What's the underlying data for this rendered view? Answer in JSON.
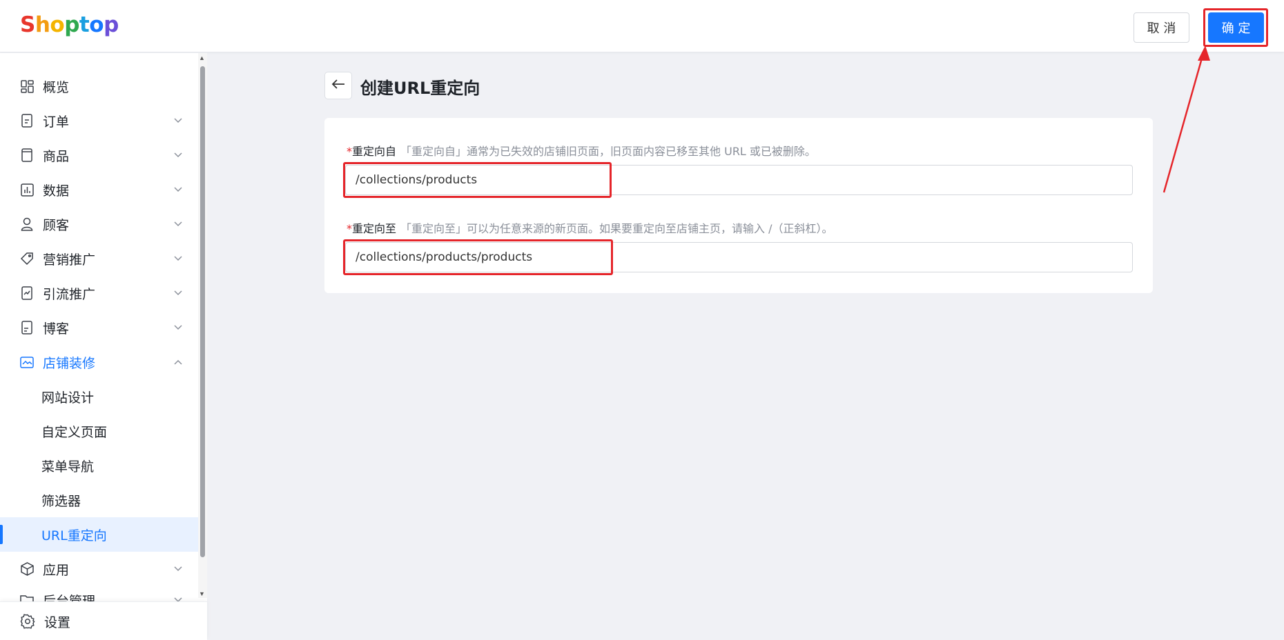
{
  "header": {
    "logo_letters": [
      {
        "ch": "S",
        "color": "#e8362c"
      },
      {
        "ch": "h",
        "color": "#f39c12"
      },
      {
        "ch": "o",
        "color": "#f4b400"
      },
      {
        "ch": "p",
        "color": "#2fa84f"
      },
      {
        "ch": "t",
        "color": "#1a9fe0"
      },
      {
        "ch": "o",
        "color": "#1677ff"
      },
      {
        "ch": "p",
        "color": "#6b4fd8"
      }
    ],
    "cancel_label": "取 消",
    "confirm_label": "确 定"
  },
  "sidebar": {
    "items": [
      {
        "label": "概览",
        "icon": "dashboard-icon",
        "has_chevron": false
      },
      {
        "label": "订单",
        "icon": "order-icon",
        "has_chevron": true
      },
      {
        "label": "商品",
        "icon": "product-icon",
        "has_chevron": true
      },
      {
        "label": "数据",
        "icon": "chart-icon",
        "has_chevron": true
      },
      {
        "label": "顾客",
        "icon": "user-icon",
        "has_chevron": true
      },
      {
        "label": "营销推广",
        "icon": "tag-icon",
        "has_chevron": true
      },
      {
        "label": "引流推广",
        "icon": "traffic-icon",
        "has_chevron": true
      },
      {
        "label": "博客",
        "icon": "blog-icon",
        "has_chevron": true
      },
      {
        "label": "店铺装修",
        "icon": "store-icon",
        "has_chevron": true,
        "expanded": true
      }
    ],
    "sub_items": [
      {
        "label": "网站设计"
      },
      {
        "label": "自定义页面"
      },
      {
        "label": "菜单导航"
      },
      {
        "label": "筛选器"
      },
      {
        "label": "URL重定向",
        "selected": true
      }
    ],
    "after_items": [
      {
        "label": "应用",
        "icon": "app-icon"
      },
      {
        "label": "后台管理",
        "icon": "folder-icon"
      }
    ],
    "settings_label": "设置"
  },
  "main": {
    "title": "创建URL重定向",
    "from": {
      "required_mark": "*",
      "label": "重定向自",
      "hint": "「重定向自」通常为已失效的店铺旧页面，旧页面内容已移至其他 URL 或已被删除。",
      "value": "/collections/products"
    },
    "to": {
      "required_mark": "*",
      "label": "重定向至",
      "hint": "「重定向至」可以为任意来源的新页面。如果要重定向至店铺主页，请输入 /（正斜杠）。",
      "value": "/collections/products/products"
    }
  },
  "colors": {
    "accent": "#1677ff",
    "highlight": "#e5252a"
  }
}
